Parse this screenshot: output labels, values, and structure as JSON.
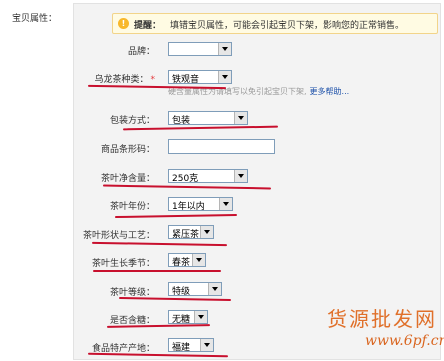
{
  "section_label": "宝贝属性：",
  "tip": {
    "icon": "!",
    "title": "提醒：",
    "text": "填错宝贝属性，可能会引起宝贝下架，影响您的正常销售。"
  },
  "fields": [
    {
      "label": "品牌：",
      "value": ""
    },
    {
      "label": "乌龙茶种类：",
      "required_mark": "*",
      "value": "铁观音"
    },
    {
      "label": "包装方式：",
      "value": "包装"
    },
    {
      "label": "商品条形码：",
      "value": ""
    },
    {
      "label": "茶叶净含量：",
      "value": "250克"
    },
    {
      "label": "茶叶年份：",
      "value": "1年以内"
    },
    {
      "label": "茶叶形状与工艺：",
      "value": "紧压茶"
    },
    {
      "label": "茶叶生长季节：",
      "value": "春茶"
    },
    {
      "label": "茶叶等级：",
      "value": "特级"
    },
    {
      "label": "是否含糖：",
      "value": "无糖"
    },
    {
      "label": "食品特产产地：",
      "value": "福建"
    }
  ],
  "hint": {
    "text": "硬含量属性为请填写以免引起宝贝下架,",
    "link": "更多帮助..."
  },
  "watermark": {
    "line1": "货源批发网",
    "line2": "www.6pf.cn"
  },
  "colors": {
    "annotation": "#c8102e",
    "tip_bg": "#fffbe3",
    "link": "#1b4fa8"
  }
}
